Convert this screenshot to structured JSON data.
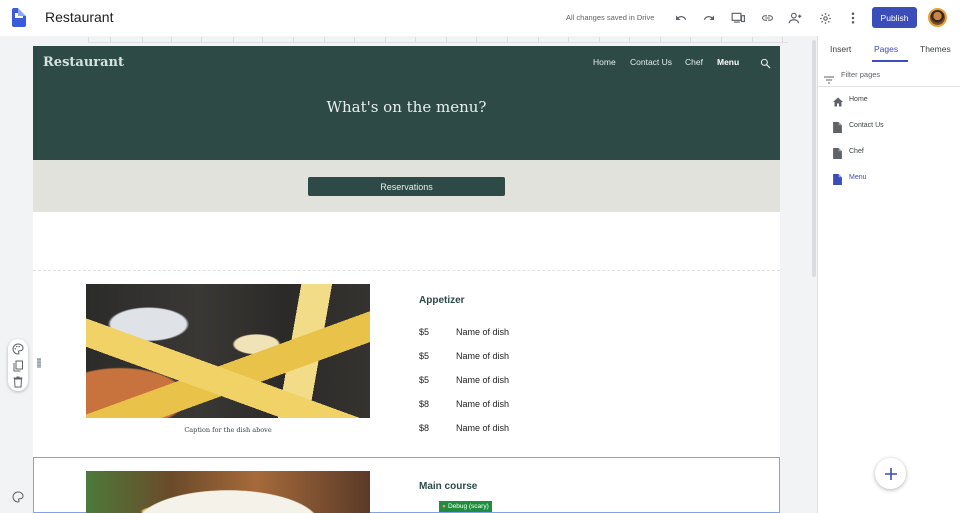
{
  "app": {
    "title": "Restaurant",
    "save_status": "All changes saved in Drive",
    "publish_label": "Publish"
  },
  "site": {
    "title": "Restaurant",
    "nav": [
      "Home",
      "Contact Us",
      "Chef",
      "Menu"
    ],
    "active_nav": "Menu",
    "hero_heading": "What's on the menu?",
    "reservations_label": "Reservations",
    "caption": "Caption for the dish above",
    "appetizer": {
      "title": "Appetizer",
      "items": [
        {
          "price": "$5",
          "name": "Name of dish"
        },
        {
          "price": "$5",
          "name": "Name of dish"
        },
        {
          "price": "$5",
          "name": "Name of dish"
        },
        {
          "price": "$8",
          "name": "Name of dish"
        },
        {
          "price": "$8",
          "name": "Name of dish"
        }
      ]
    },
    "main_course": {
      "title": "Main course",
      "debug_badge": "Debug (scary)"
    }
  },
  "panel": {
    "tabs": [
      "Insert",
      "Pages",
      "Themes"
    ],
    "active_tab": "Pages",
    "filter_placeholder": "Filter pages",
    "pages": [
      "Home",
      "Contact Us",
      "Chef",
      "Menu"
    ],
    "active_page": "Menu"
  },
  "colors": {
    "accent": "#3b4db8",
    "hero": "#2d4a47",
    "band": "#e2e2dd"
  },
  "icons": [
    "undo-icon",
    "redo-icon",
    "preview-icon",
    "link-icon",
    "share-icon",
    "settings-icon",
    "more-icon",
    "search-icon",
    "filter-icon",
    "home-icon",
    "page-icon",
    "add-icon",
    "palette-icon",
    "duplicate-icon",
    "delete-icon"
  ]
}
